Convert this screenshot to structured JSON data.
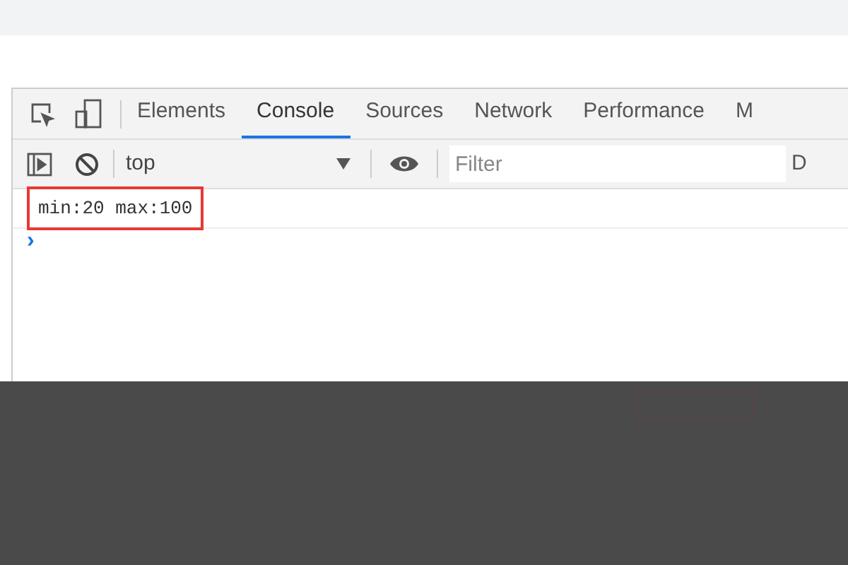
{
  "tabs": [
    {
      "label": "Elements",
      "selected": false
    },
    {
      "label": "Console",
      "selected": true
    },
    {
      "label": "Sources",
      "selected": false
    },
    {
      "label": "Network",
      "selected": false
    },
    {
      "label": "Performance",
      "selected": false
    },
    {
      "label": "M",
      "selected": false
    }
  ],
  "toolbar": {
    "context": "top",
    "filter": {
      "placeholder": "Filter"
    },
    "cut_label": "D"
  },
  "console": {
    "messages": [
      {
        "text": "min:20 max:100",
        "highlighted": true
      }
    ],
    "prompt": "›"
  }
}
